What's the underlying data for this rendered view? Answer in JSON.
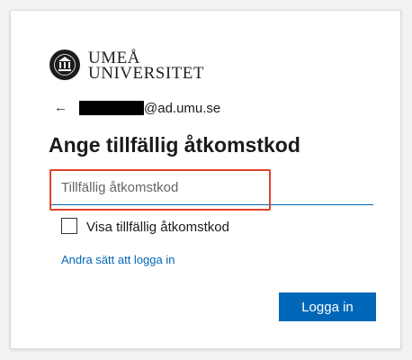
{
  "logo": {
    "line1": "UMEÅ",
    "line2": "UNIVERSITET",
    "icon": "university-seal-icon"
  },
  "account": {
    "back_icon": "arrow-left-icon",
    "email_domain": "@ad.umu.se"
  },
  "title": "Ange tillfällig åtkomstkod",
  "code_input": {
    "placeholder": "Tillfällig åtkomstkod",
    "value": ""
  },
  "show_code_checkbox": {
    "label": "Visa tillfällig åtkomstkod",
    "checked": false
  },
  "alt_signin_link": "Andra sätt att logga in",
  "submit_button": "Logga in",
  "colors": {
    "accent": "#0067b8",
    "highlight": "#e0412a",
    "background": "#f2f2f2"
  }
}
